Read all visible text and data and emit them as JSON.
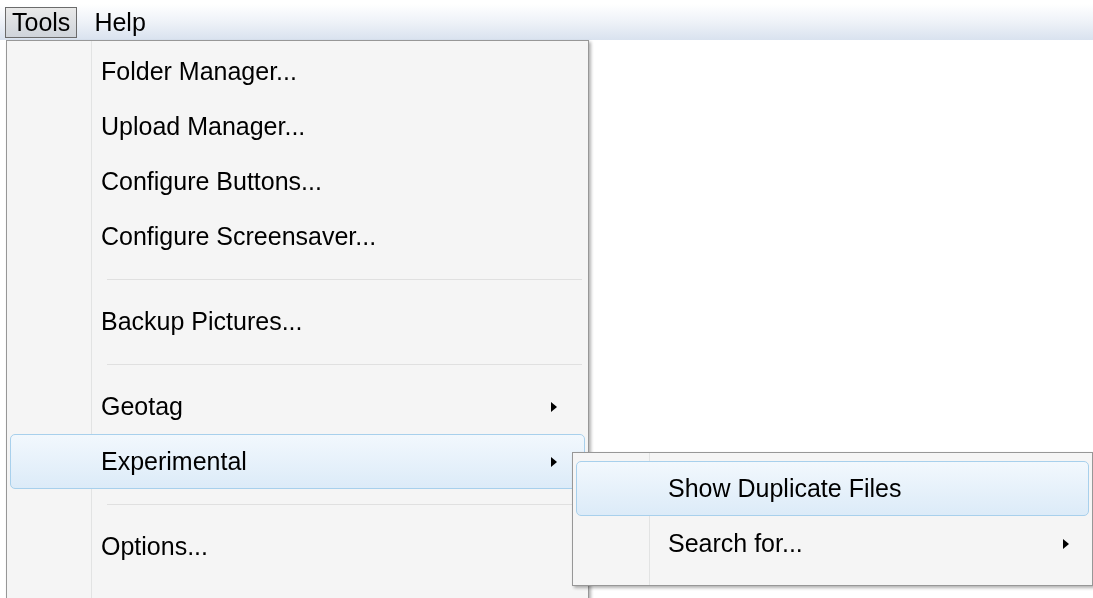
{
  "menubar": [
    {
      "label": "Tools",
      "selected": true
    },
    {
      "label": "Help",
      "selected": false
    }
  ],
  "menu": [
    {
      "kind": "item",
      "label": "Folder Manager...",
      "submenu": false,
      "highlighted": false
    },
    {
      "kind": "item",
      "label": "Upload Manager...",
      "submenu": false,
      "highlighted": false
    },
    {
      "kind": "item",
      "label": "Configure Buttons...",
      "submenu": false,
      "highlighted": false
    },
    {
      "kind": "item",
      "label": "Configure Screensaver...",
      "submenu": false,
      "highlighted": false
    },
    {
      "kind": "separator"
    },
    {
      "kind": "item",
      "label": "Backup Pictures...",
      "submenu": false,
      "highlighted": false
    },
    {
      "kind": "separator"
    },
    {
      "kind": "item",
      "label": "Geotag",
      "submenu": true,
      "highlighted": false
    },
    {
      "kind": "item",
      "label": "Experimental",
      "submenu": true,
      "highlighted": true
    },
    {
      "kind": "separator"
    },
    {
      "kind": "item",
      "label": "Options...",
      "submenu": false,
      "highlighted": false
    }
  ],
  "submenu": [
    {
      "kind": "item",
      "label": "Show Duplicate Files",
      "submenu": false,
      "highlighted": true
    },
    {
      "kind": "item",
      "label": "Search for...",
      "submenu": true,
      "highlighted": false
    }
  ]
}
